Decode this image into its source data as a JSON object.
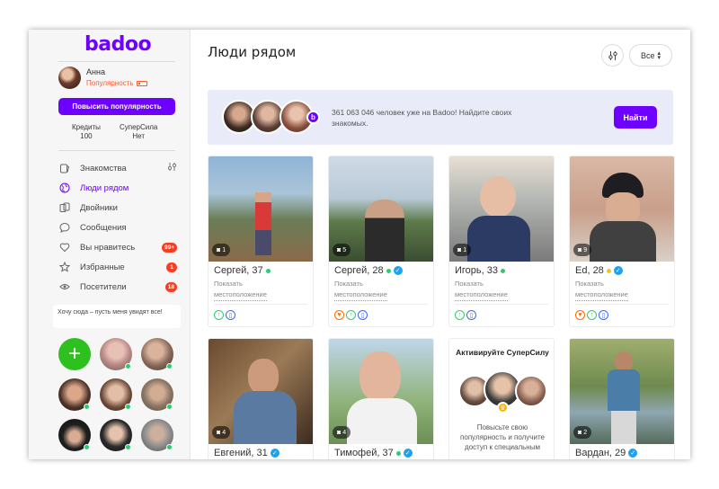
{
  "app": {
    "logo": "badoo"
  },
  "profile": {
    "name": "Анна",
    "popularity_label": "Популярность"
  },
  "sidebar": {
    "boost_button": "Повысить популярность",
    "credits_label": "Кредиты",
    "credits_value": "100",
    "superpower_label": "СуперСила",
    "superpower_value": "Нет",
    "items": [
      {
        "label": "Знакомства"
      },
      {
        "label": "Люди рядом"
      },
      {
        "label": "Двойники"
      },
      {
        "label": "Сообщения"
      },
      {
        "label": "Вы нравитесь",
        "badge": "99+"
      },
      {
        "label": "Избранные",
        "badge": "1"
      },
      {
        "label": "Посетители",
        "badge": "18"
      }
    ],
    "want_here": "Хочу сюда – пусть меня увидят все!",
    "add_icon": "+"
  },
  "main": {
    "title": "Люди рядом",
    "filter_select": "Все",
    "banner_text": "361 063 046 человек уже на Badoo! Найдите своих знакомых.",
    "find_button": "Найти",
    "cards": [
      {
        "name": "Сергей, 37",
        "photos": "1",
        "show": "Показать",
        "location": "местоположение"
      },
      {
        "name": "Сергей, 28",
        "photos": "5",
        "show": "Показать",
        "location": "местоположение"
      },
      {
        "name": "Игорь, 33",
        "photos": "1",
        "show": "Показать",
        "location": "местоположение"
      },
      {
        "name": "Ed, 28",
        "photos": "9",
        "show": "Показать",
        "location": "местоположение"
      },
      {
        "name": "Евгений, 31",
        "photos": "4"
      },
      {
        "name": "Тимофей, 37",
        "photos": "4"
      },
      {
        "name": "Вардан, 29",
        "photos": "2"
      }
    ],
    "super": {
      "title": "Активируйте СуперСилу",
      "text": "Повысьте свою популярность и получите доступ к специальным"
    }
  },
  "colors": {
    "accent": "#6e00ff",
    "badge": "#ff3b1f",
    "online": "#2ecc71",
    "verified": "#1da1f2"
  }
}
